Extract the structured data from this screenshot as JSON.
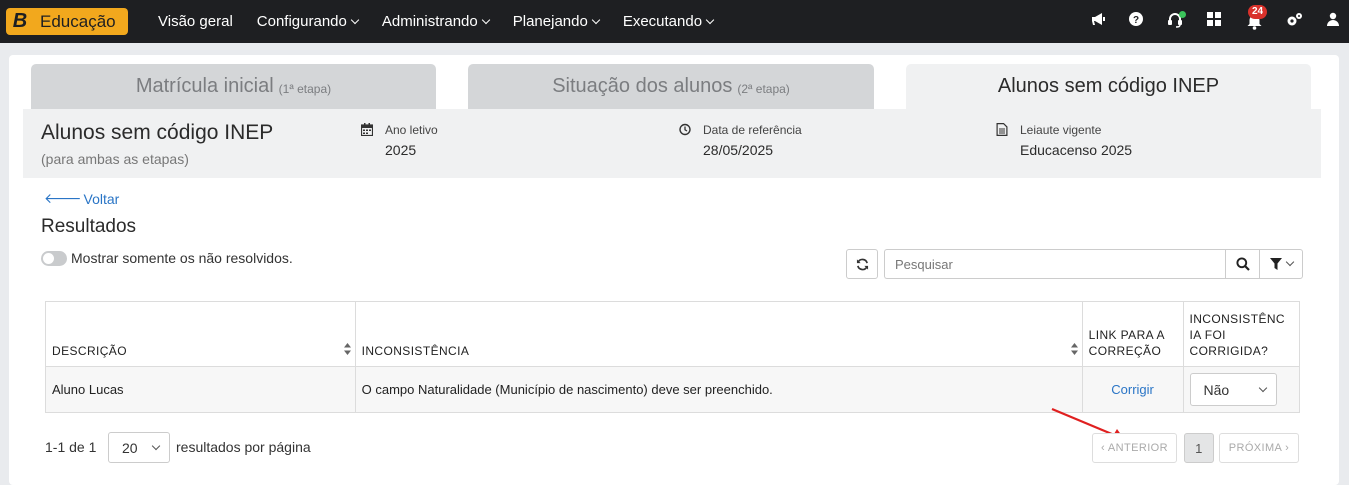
{
  "nav": {
    "logo_letter": "B",
    "logo_text": "Educação",
    "items": [
      {
        "label": "Visão geral",
        "has_caret": false
      },
      {
        "label": "Configurando",
        "has_caret": true
      },
      {
        "label": "Administrando",
        "has_caret": true
      },
      {
        "label": "Planejando",
        "has_caret": true
      },
      {
        "label": "Executando",
        "has_caret": true
      }
    ],
    "right_icons": [
      "megaphone-icon",
      "help-icon",
      "headset-icon",
      "apps-grid-icon",
      "bell-icon",
      "settings-icon",
      "user-icon"
    ],
    "notification_count": "24"
  },
  "tabs": [
    {
      "label": "Matrícula inicial",
      "small": "(1ª etapa)",
      "active": false
    },
    {
      "label": "Situação dos alunos",
      "small": "(2ª etapa)",
      "active": false
    },
    {
      "label": "Alunos sem código INEP",
      "small": "",
      "active": true
    }
  ],
  "header": {
    "title": "Alunos sem código INEP",
    "subtitle": "(para ambas as etapas)",
    "meta": [
      {
        "icon": "calendar-icon",
        "label": "Ano letivo",
        "value": "2025"
      },
      {
        "icon": "clock-icon",
        "label": "Data de referência",
        "value": "28/05/2025"
      },
      {
        "icon": "document-icon",
        "label": "Leiaute vigente",
        "value": "Educacenso 2025"
      }
    ]
  },
  "back_link": "Voltar",
  "results_title": "Resultados",
  "toggle_label": "Mostrar somente os não resolvidos.",
  "search": {
    "placeholder": "Pesquisar",
    "value": ""
  },
  "table": {
    "columns": [
      "DESCRIÇÃO",
      "INCONSISTÊNCIA",
      "LINK PARA A CORREÇÃO",
      "INCONSISTÊNCIA FOI CORRIGIDA?"
    ],
    "col_descricao": "DESCRIÇÃO",
    "col_inconsistencia": "INCONSISTÊNCIA",
    "col_link": "LINK PARA A CORREÇÃO",
    "col_corrigida": "INCONSISTÊNC IA FOI CORRIGIDA?",
    "rows": [
      {
        "descricao": "Aluno Lucas",
        "inconsistencia": "O campo Naturalidade (Município de nascimento) deve ser preenchido.",
        "link": "Corrigir",
        "corrigida": "Não"
      }
    ]
  },
  "pagination": {
    "range": "1-1 de 1",
    "per_page": "20",
    "per_page_label": "resultados por página",
    "prev": "‹ ANTERIOR",
    "current": "1",
    "next": "PRÓXIMA ›"
  },
  "colors": {
    "topbar": "#1e1f22",
    "brand": "#f2a81d",
    "link": "#2a75c6",
    "badge": "#d9312b",
    "annotation_arrow": "#e02020"
  }
}
